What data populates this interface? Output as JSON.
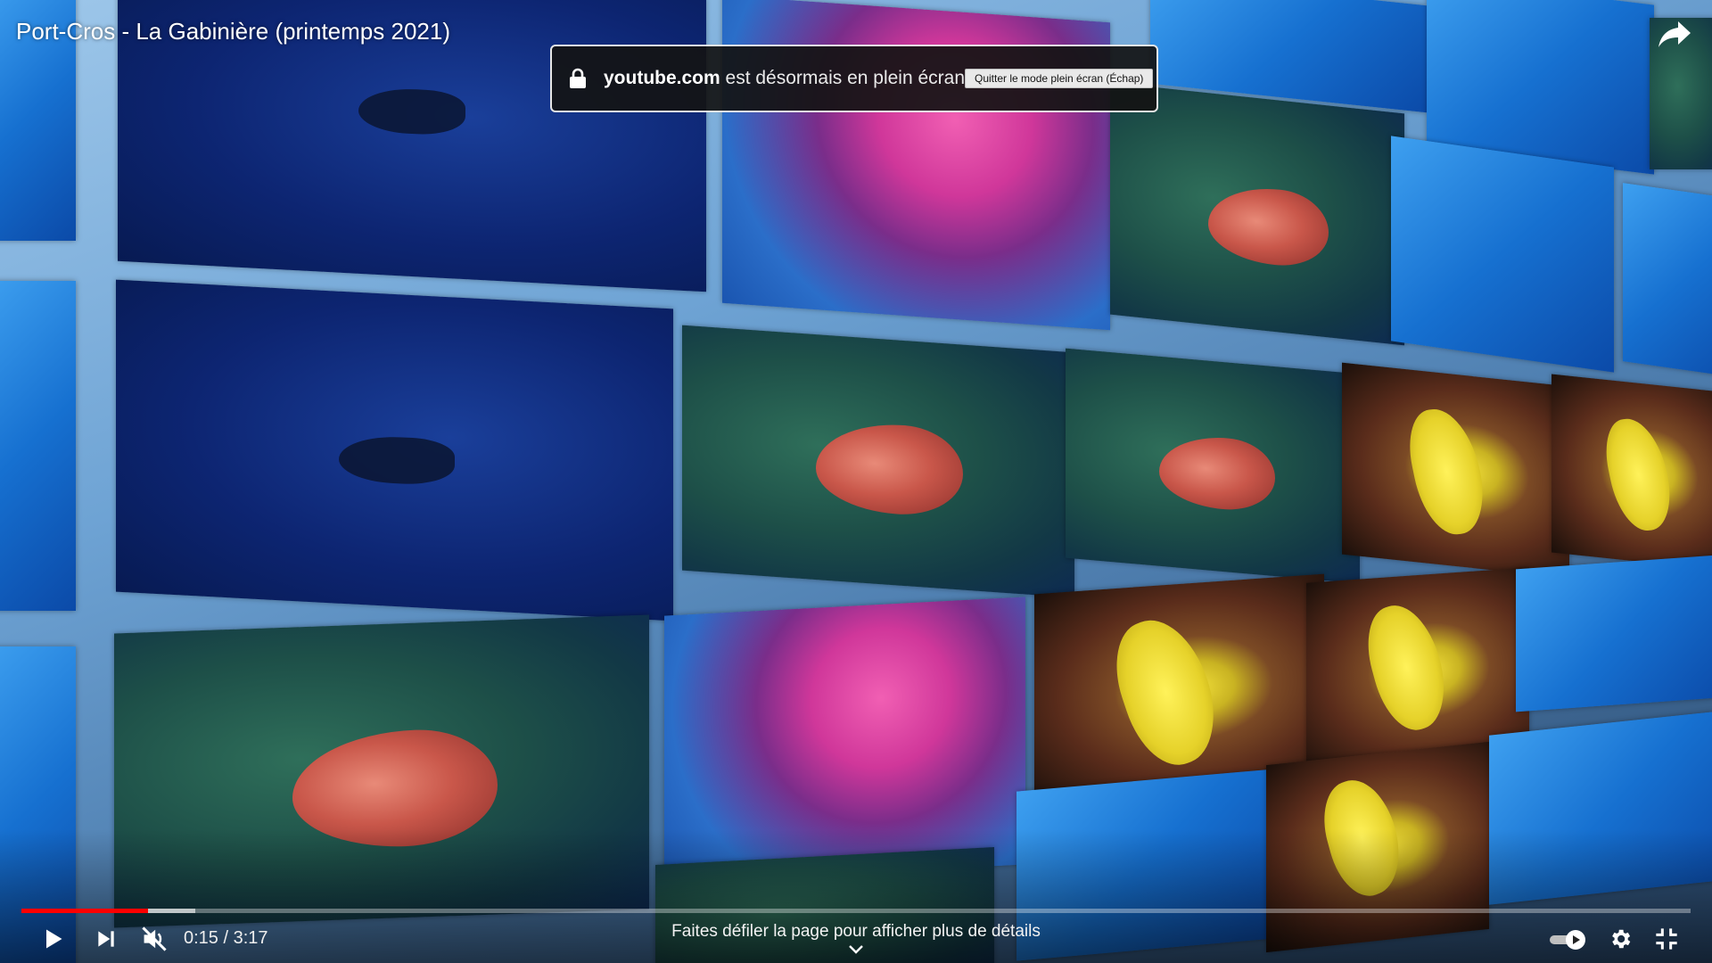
{
  "video": {
    "title": "Port-Cros - La Gabinière (printemps 2021)"
  },
  "fullscreen_notice": {
    "domain": "youtube.com",
    "message": " est désormais en plein écran",
    "exit_label": "Quitter le mode plein écran (Échap)"
  },
  "player": {
    "current_time": "0:15",
    "duration": "3:17",
    "time_display": "0:15 / 3:17",
    "progress_fraction": 0.076,
    "buffered_fraction": 0.104,
    "scroll_hint": "Faites défiler la page pour afficher plus de détails",
    "muted": true,
    "autoplay_on": true
  },
  "icons": {
    "share": "share-icon",
    "lock": "lock-icon",
    "play": "play-icon",
    "next": "next-icon",
    "mute": "volume-muted-icon",
    "autoplay": "autoplay-toggle-icon",
    "settings": "gear-icon",
    "exit_fullscreen": "exit-fullscreen-icon",
    "chevron": "chevron-down-icon"
  },
  "colors": {
    "progress_played": "#ff0000",
    "notice_bg": "#141414"
  }
}
